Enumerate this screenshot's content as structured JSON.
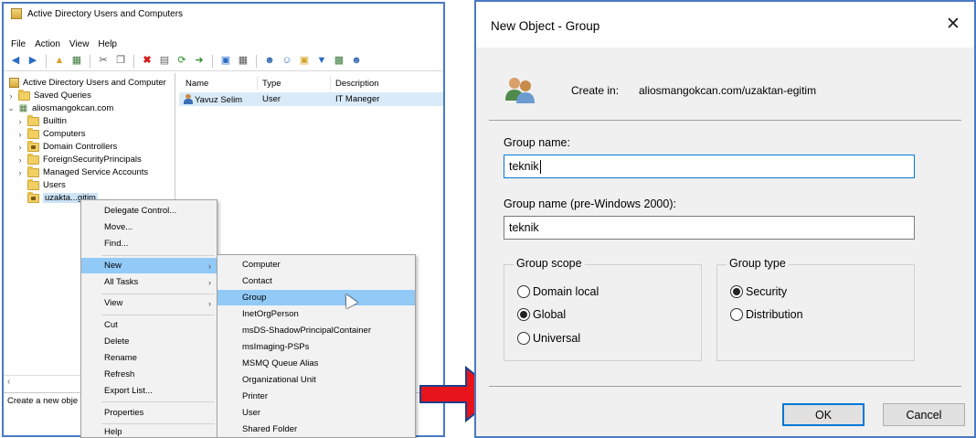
{
  "aduc": {
    "title": "Active Directory Users and Computers",
    "menu": [
      "File",
      "Action",
      "View",
      "Help"
    ],
    "tree": {
      "root": "Active Directory Users and Computer",
      "saved_queries": "Saved Queries",
      "domain": "aliosmangokcan.com",
      "children": [
        "Builtin",
        "Computers",
        "Domain Controllers",
        "ForeignSecurityPrincipals",
        "Managed Service Accounts",
        "Users",
        "uzakta...gitim"
      ]
    },
    "list": {
      "headers": [
        "Name",
        "Type",
        "Description"
      ],
      "rows": [
        {
          "name": "Yavuz Selim",
          "type": "User",
          "description": "IT Maneger"
        }
      ]
    },
    "status": "Create a new obje"
  },
  "context_menu": {
    "items": [
      "Delegate Control...",
      "Move...",
      "Find...",
      "New",
      "All Tasks",
      "View",
      "Cut",
      "Delete",
      "Rename",
      "Refresh",
      "Export List...",
      "Properties",
      "Help"
    ]
  },
  "submenu": {
    "items": [
      "Computer",
      "Contact",
      "Group",
      "InetOrgPerson",
      "msDS-ShadowPrincipalContainer",
      "msImaging-PSPs",
      "MSMQ Queue Alias",
      "Organizational Unit",
      "Printer",
      "User",
      "Shared Folder"
    ]
  },
  "dialog": {
    "title": "New Object - Group",
    "create_in_label": "Create in:",
    "create_in_path": "aliosmangokcan.com/uzaktan-egitim",
    "group_name_label": "Group name:",
    "group_name_value": "teknik",
    "group_name_pre2000_label": "Group name (pre-Windows 2000):",
    "group_name_pre2000_value": "teknik",
    "scope": {
      "title": "Group scope",
      "options": [
        "Domain local",
        "Global",
        "Universal"
      ],
      "selected": "Global"
    },
    "type": {
      "title": "Group type",
      "options": [
        "Security",
        "Distribution"
      ],
      "selected": "Security"
    },
    "ok_label": "OK",
    "cancel_label": "Cancel"
  },
  "colors": {
    "window_border": "#4a79c4",
    "menu_highlight": "#91c9f7",
    "arrow_red": "#e8141b",
    "focus_blue": "#0078d7"
  }
}
